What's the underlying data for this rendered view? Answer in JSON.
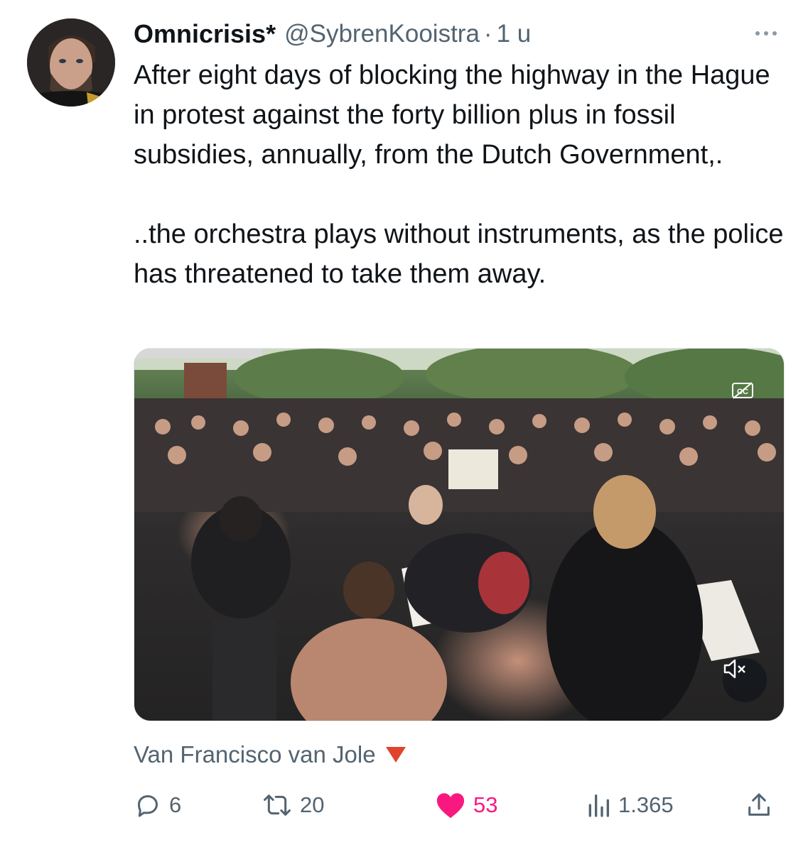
{
  "tweet": {
    "author": {
      "display_name": "Omnicrisis*",
      "handle": "@SybrenKooistra",
      "separator": "·",
      "time": "1 u"
    },
    "text_paragraphs": [
      "After eight days of blocking the highway in the Hague in protest against the forty billion plus in fossil subsidies, annually, from the Dutch Government,.",
      "..the orchestra plays without instruments, as the police has threatened to take them away."
    ],
    "media": {
      "type": "video",
      "icons": [
        "captions-off-icon",
        "volume-muted-icon"
      ]
    },
    "attribution": "Van Francisco van Jole",
    "stats": {
      "replies": "6",
      "retweets": "20",
      "likes": "53",
      "views": "1.365"
    }
  },
  "colors": {
    "text": "#0f1419",
    "secondary": "#536471",
    "like": "#f91880",
    "attribution_triangle": "#e0442b"
  }
}
